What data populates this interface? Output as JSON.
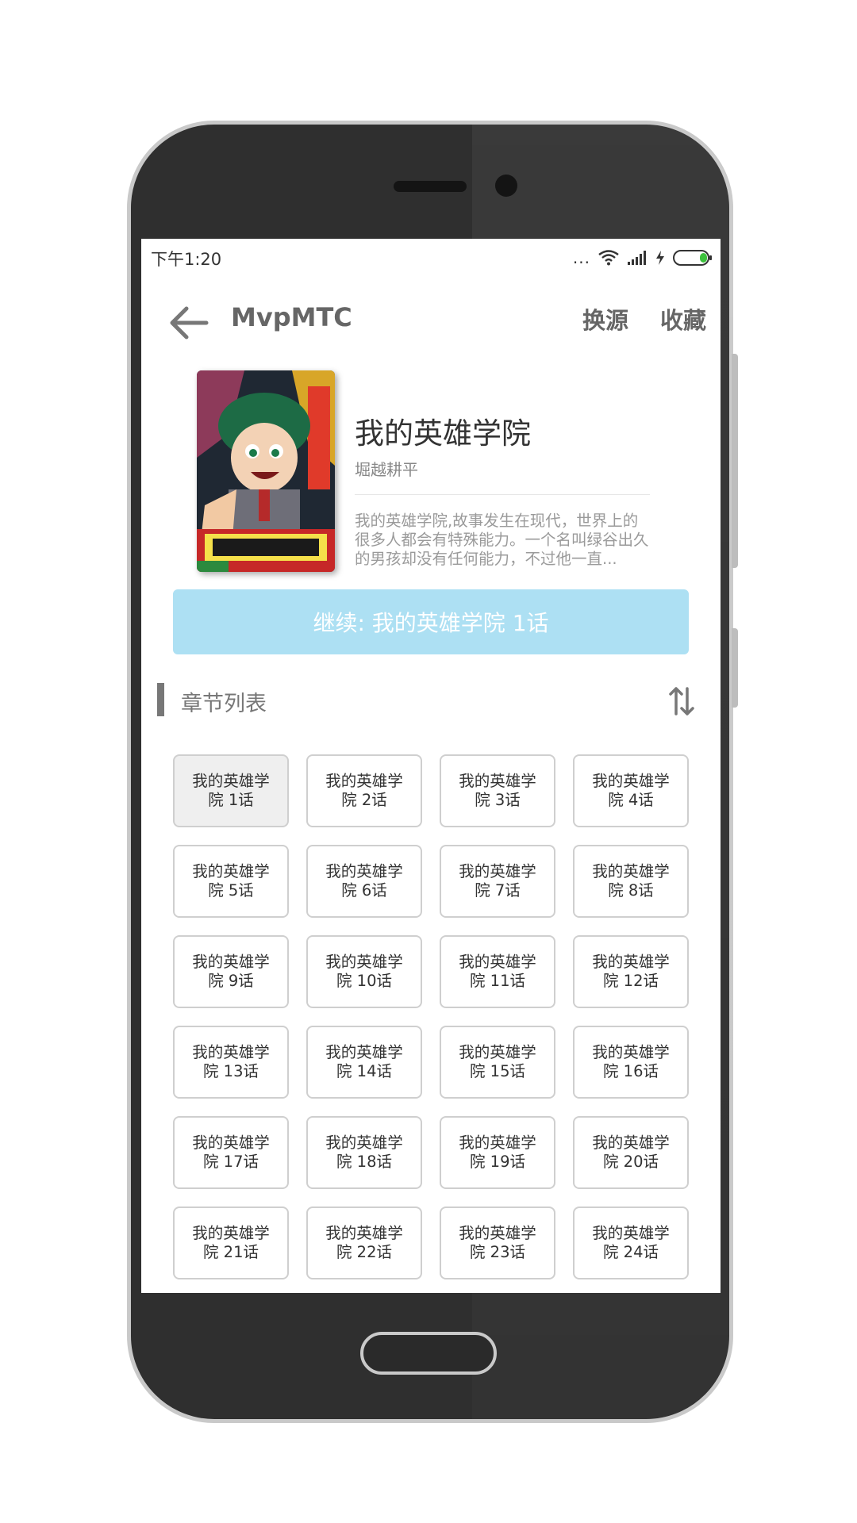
{
  "status_bar": {
    "time": "下午1:20",
    "dots": "..."
  },
  "toolbar": {
    "title": "MvpMTC",
    "switch_source": "换源",
    "favorite": "收藏"
  },
  "comic": {
    "title": "我的英雄学院",
    "author": "堀越耕平",
    "description": "我的英雄学院,故事发生在现代，世界上的很多人都会有特殊能力。一个名叫绿谷出久的男孩却没有任何能力，不过他一直..."
  },
  "continue_button": "继续: 我的英雄学院 1话",
  "chapter_section": {
    "title": "章节列表"
  },
  "chapters": [
    "我的英雄学院 1话",
    "我的英雄学院 2话",
    "我的英雄学院 3话",
    "我的英雄学院 4话",
    "我的英雄学院 5话",
    "我的英雄学院 6话",
    "我的英雄学院 7话",
    "我的英雄学院 8话",
    "我的英雄学院 9话",
    "我的英雄学院 10话",
    "我的英雄学院 11话",
    "我的英雄学院 12话",
    "我的英雄学院 13话",
    "我的英雄学院 14话",
    "我的英雄学院 15话",
    "我的英雄学院 16话",
    "我的英雄学院 17话",
    "我的英雄学院 18话",
    "我的英雄学院 19话",
    "我的英雄学院 20话",
    "我的英雄学院 21话",
    "我的英雄学院 22话",
    "我的英雄学院 23话",
    "我的英雄学院 24话"
  ],
  "colors": {
    "accent": "#ade0f3",
    "frame": "#2f2f2f",
    "battery": "#3cc13c"
  }
}
